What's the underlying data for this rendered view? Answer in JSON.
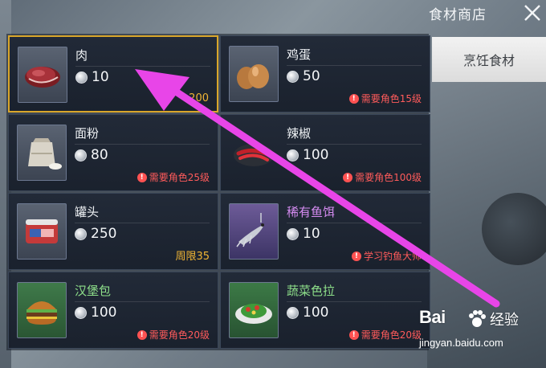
{
  "header": {
    "title": "食材商店"
  },
  "side_tab": {
    "label": "烹饪食材"
  },
  "items": [
    {
      "name": "肉",
      "price": "10",
      "requirement": "",
      "icon": "meat-icon",
      "selected": true,
      "partial_hint": "200"
    },
    {
      "name": "鸡蛋",
      "price": "50",
      "requirement": "需要角色15级",
      "icon": "egg-icon"
    },
    {
      "name": "面粉",
      "price": "80",
      "requirement": "需要角色25级",
      "icon": "flour-sack-icon"
    },
    {
      "name": "辣椒",
      "price": "100",
      "requirement": "需要角色100级",
      "icon": "chili-icon"
    },
    {
      "name": "罐头",
      "price": "250",
      "limit": "周限35",
      "icon": "canned-meat-icon"
    },
    {
      "name": "稀有鱼饵",
      "price": "10",
      "requirement": "学习钓鱼大师",
      "icon": "fish-bait-icon",
      "name_color": "purple"
    },
    {
      "name": "汉堡包",
      "price": "100",
      "requirement": "需要角色20级",
      "icon": "burger-icon",
      "name_color": "green"
    },
    {
      "name": "蔬菜色拉",
      "price": "100",
      "requirement": "需要角色20级",
      "icon": "salad-icon",
      "name_color": "green"
    }
  ],
  "watermark": {
    "logo": "Bai",
    "logo_suffix": "经验",
    "url": "jingyan.baidu.com"
  },
  "colors": {
    "selected_border": "#d9a62a",
    "requirement_red": "#ff5b5b",
    "weekly_orange": "#f0b534",
    "rare_purple": "#d68cf2",
    "dish_green": "#8ee08a",
    "annotation_arrow": "#e845e8"
  }
}
